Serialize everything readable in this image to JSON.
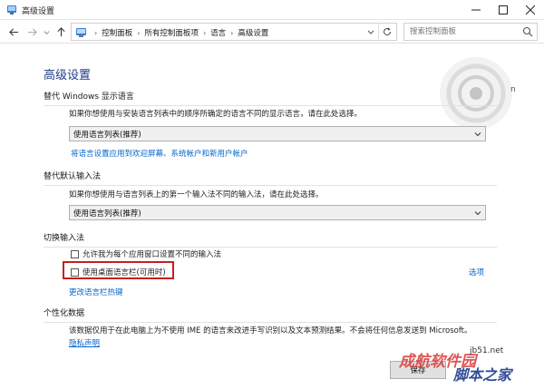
{
  "window": {
    "title": "高级设置"
  },
  "address": {
    "crumbs": [
      "控制面板",
      "所有控制面板项",
      "语言",
      "高级设置"
    ],
    "search_placeholder": "搜索控制面板"
  },
  "page": {
    "title": "高级设置",
    "stray_char": "n",
    "display_language": {
      "title": "替代 Windows 显示语言",
      "description": "如果你想使用与安装语言列表中的顺序所确定的语言不同的显示语言，请在此处选择。",
      "select_value": "使用语言列表(推荐)",
      "link": "将语言设置应用到欢迎屏幕、系统帐户和新用户帐户"
    },
    "input_method": {
      "title": "替代默认输入法",
      "description": "如果你想使用与语言列表上的第一个输入法不同的输入法，请在此处选择。",
      "select_value": "使用语言列表(推荐)"
    },
    "switching": {
      "title": "切换输入法",
      "checkbox_per_app": "允许我为每个应用窗口设置不同的输入法",
      "checkbox_desktop_bar": "使用桌面语言栏(可用时)",
      "options_link": "选项",
      "hotkeys_link": "更改语言栏热键"
    },
    "personalization": {
      "title": "个性化数据",
      "description": "该数据仅用于在此电脑上为不使用 IME 的语言来改进手写识别以及文本预测结果。不会将任何信息发送到 Microsoft。",
      "privacy_link": "隐私声明"
    },
    "save_label": "保存"
  },
  "watermark": {
    "line1": "成航软件园",
    "line2": "jb51.net",
    "line3": "脚本之家"
  },
  "colors": {
    "accent_link": "#0066cc",
    "title_blue": "#1e3a8a",
    "highlight_red": "#c81e1e"
  }
}
